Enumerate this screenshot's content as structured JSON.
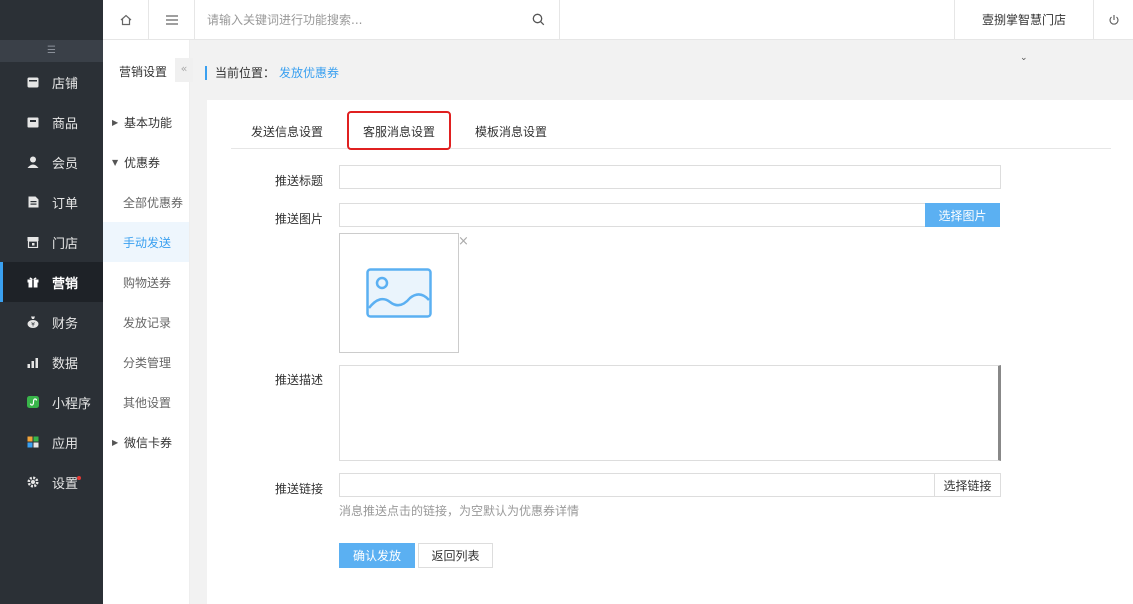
{
  "sidebar": {
    "collapse_icon": "menu-collapse-icon",
    "items": [
      {
        "label": "店铺",
        "icon": "store-icon",
        "active": false
      },
      {
        "label": "商品",
        "icon": "goods-icon",
        "active": false
      },
      {
        "label": "会员",
        "icon": "member-icon",
        "active": false
      },
      {
        "label": "订单",
        "icon": "order-icon",
        "active": false
      },
      {
        "label": "门店",
        "icon": "shop-icon",
        "active": false
      },
      {
        "label": "营销",
        "icon": "gift-icon",
        "active": true
      },
      {
        "label": "财务",
        "icon": "money-bag-icon",
        "active": false
      },
      {
        "label": "数据",
        "icon": "bar-chart-icon",
        "active": false
      },
      {
        "label": "小程序",
        "icon": "miniprogram-icon",
        "active": false
      },
      {
        "label": "应用",
        "icon": "apps-icon",
        "active": false
      },
      {
        "label": "设置",
        "icon": "gear-icon",
        "active": false,
        "badge_dot": true
      }
    ]
  },
  "topbar": {
    "search_placeholder": "请输入关键词进行功能搜索...",
    "store_name": "壹捌掌智慧门店"
  },
  "subnav": {
    "title": "营销设置",
    "collapse_glyph": "«",
    "groups": [
      {
        "label": "基本功能",
        "expanded": false
      },
      {
        "label": "优惠券",
        "expanded": true
      }
    ],
    "items": [
      {
        "label": "全部优惠券",
        "active": false
      },
      {
        "label": "手动发送",
        "active": true
      },
      {
        "label": "购物送券",
        "active": false
      },
      {
        "label": "发放记录",
        "active": false
      },
      {
        "label": "分类管理",
        "active": false
      },
      {
        "label": "其他设置",
        "active": false
      }
    ],
    "last_group": {
      "label": "微信卡券",
      "expanded": false
    }
  },
  "breadcrumb": {
    "label": "当前位置：",
    "current": "发放优惠券"
  },
  "tabs": [
    {
      "label": "发送信息设置"
    },
    {
      "label": "客服消息设置",
      "highlighted": true
    },
    {
      "label": "模板消息设置"
    }
  ],
  "form": {
    "title_label": "推送标题",
    "title_value": "",
    "image_label": "推送图片",
    "image_value": "",
    "select_image_button": "选择图片",
    "image_close_glyph": "×",
    "desc_label": "推送描述",
    "desc_value": "",
    "link_label": "推送链接",
    "link_value": "",
    "select_link_button": "选择链接",
    "link_hint": "消息推送点击的链接，为空默认为优惠券详情",
    "confirm_button": "确认发放",
    "back_button": "返回列表"
  },
  "colors": {
    "accent": "#3aa0f0",
    "button_blue": "#5bb0f2",
    "sidebar_bg": "#2b3036",
    "highlight_border": "#e02020"
  }
}
